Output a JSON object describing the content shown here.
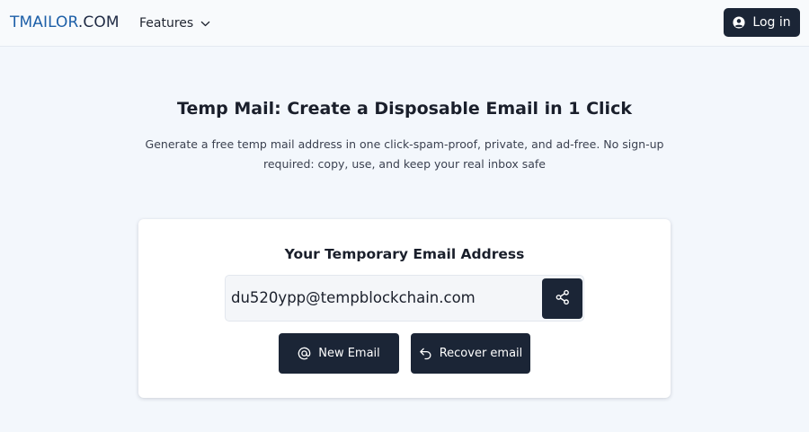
{
  "header": {
    "logo_brand": "TMAILOR",
    "logo_tld": ".COM",
    "features_label": "Features",
    "features_icon": "chevron-down-icon",
    "login_label": "Log in",
    "login_icon": "user-circle-icon"
  },
  "hero": {
    "title": "Temp Mail: Create a Disposable Email in 1 Click",
    "subtitle": "Generate a free temp mail address in one click-spam-proof, private, and ad-free. No sign-up required: copy, use, and keep your real inbox safe"
  },
  "card": {
    "title": "Your Temporary Email Address",
    "email": "du520ypp@tempblockchain.com",
    "share_icon": "share-icon",
    "new_email_label": "New Email",
    "new_email_icon": "at-sign-icon",
    "recover_label": "Recover email",
    "recover_icon": "undo-arrow-icon"
  },
  "colors": {
    "page_bg": "#f3f7fc",
    "header_bg": "#f8fafc",
    "dark_button": "#1b2536",
    "logo_brand": "#1d5fa8"
  }
}
